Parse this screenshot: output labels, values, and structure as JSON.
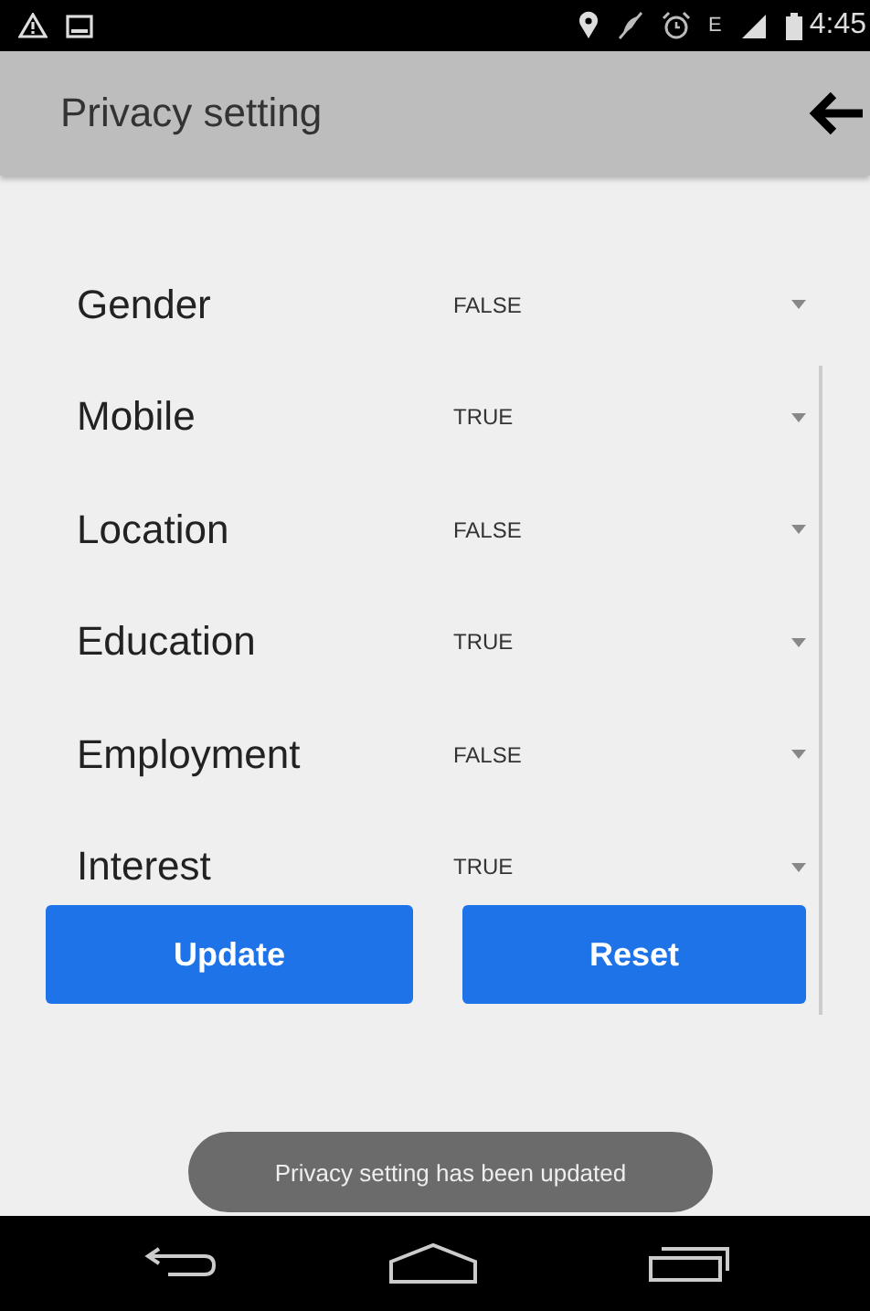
{
  "status_bar": {
    "network_type": "E",
    "time": "4:45"
  },
  "app_bar": {
    "title": "Privacy setting"
  },
  "settings": [
    {
      "label": "Gender",
      "value": "FALSE"
    },
    {
      "label": "Mobile",
      "value": "TRUE"
    },
    {
      "label": "Location",
      "value": "FALSE"
    },
    {
      "label": "Education",
      "value": "TRUE"
    },
    {
      "label": "Employment",
      "value": "FALSE"
    },
    {
      "label": "Interest",
      "value": "TRUE"
    }
  ],
  "buttons": [
    "Update",
    "Reset"
  ],
  "toast": "Privacy setting has been updated"
}
